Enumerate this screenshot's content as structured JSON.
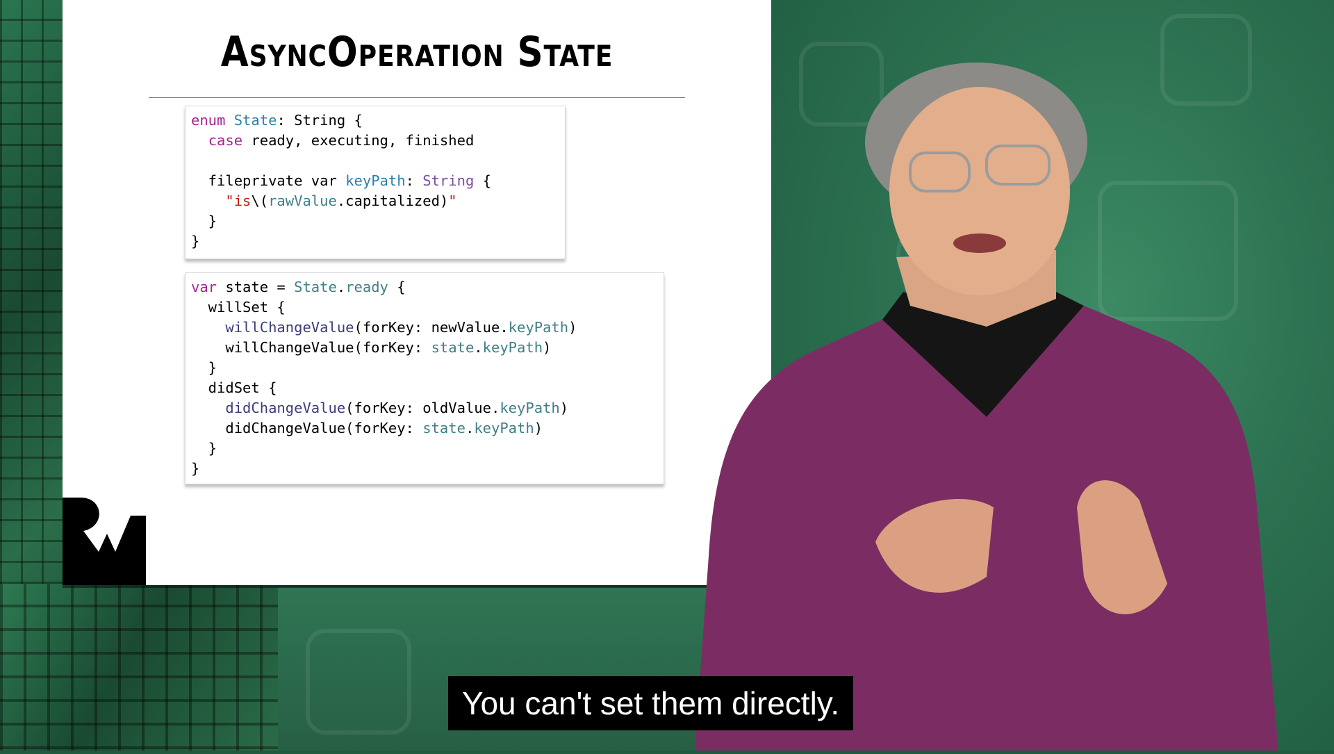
{
  "slide": {
    "title": "AsyncOperation State",
    "code_block_1": [
      [
        {
          "t": "enum",
          "c": "kw"
        },
        {
          "t": " "
        },
        {
          "t": "State",
          "c": "ty"
        },
        {
          "t": ": String {"
        }
      ],
      [
        {
          "t": "  "
        },
        {
          "t": "case",
          "c": "kw"
        },
        {
          "t": " ready, executing, finished"
        }
      ],
      [
        {
          "t": ""
        }
      ],
      [
        {
          "t": "  fileprivate var "
        },
        {
          "t": "keyPath",
          "c": "ty"
        },
        {
          "t": ": "
        },
        {
          "t": "String",
          "c": "pur"
        },
        {
          "t": " {"
        }
      ],
      [
        {
          "t": "    "
        },
        {
          "t": "\"is",
          "c": "str"
        },
        {
          "t": "\\("
        },
        {
          "t": "rawValue",
          "c": "teal"
        },
        {
          "t": ".capitalized)"
        },
        {
          "t": "\"",
          "c": "str"
        }
      ],
      [
        {
          "t": "  }"
        }
      ],
      [
        {
          "t": "}"
        }
      ]
    ],
    "code_block_2": [
      [
        {
          "t": "var",
          "c": "kw"
        },
        {
          "t": " state = "
        },
        {
          "t": "State",
          "c": "teal"
        },
        {
          "t": "."
        },
        {
          "t": "ready",
          "c": "teal"
        },
        {
          "t": " {"
        }
      ],
      [
        {
          "t": "  willSet {"
        }
      ],
      [
        {
          "t": "    "
        },
        {
          "t": "willChangeValue",
          "c": "fn"
        },
        {
          "t": "(forKey: newValue."
        },
        {
          "t": "keyPath",
          "c": "teal"
        },
        {
          "t": ")"
        }
      ],
      [
        {
          "t": "    willChangeValue(forKey: "
        },
        {
          "t": "state",
          "c": "teal"
        },
        {
          "t": "."
        },
        {
          "t": "keyPath",
          "c": "teal"
        },
        {
          "t": ")"
        }
      ],
      [
        {
          "t": "  }"
        }
      ],
      [
        {
          "t": "  didSet {"
        }
      ],
      [
        {
          "t": "    "
        },
        {
          "t": "didChangeValue",
          "c": "fn"
        },
        {
          "t": "(forKey: oldValue."
        },
        {
          "t": "keyPath",
          "c": "teal"
        },
        {
          "t": ")"
        }
      ],
      [
        {
          "t": "    didChangeValue(forKey: "
        },
        {
          "t": "state",
          "c": "teal"
        },
        {
          "t": "."
        },
        {
          "t": "keyPath",
          "c": "teal"
        },
        {
          "t": ")"
        }
      ],
      [
        {
          "t": "  }"
        }
      ],
      [
        {
          "t": "}"
        }
      ]
    ]
  },
  "caption": {
    "text": "You can't set them directly."
  },
  "colors": {
    "keyword": "#a7248c",
    "type": "#2e7fa8",
    "string": "#c41a16",
    "property": "#3f7f86",
    "backdrop_green": "#2c7151",
    "sweater": "#7b2d63"
  },
  "icons": [
    "rw-logo-icon",
    "swift-icon",
    "heart-icon",
    "lightbulb-icon"
  ]
}
